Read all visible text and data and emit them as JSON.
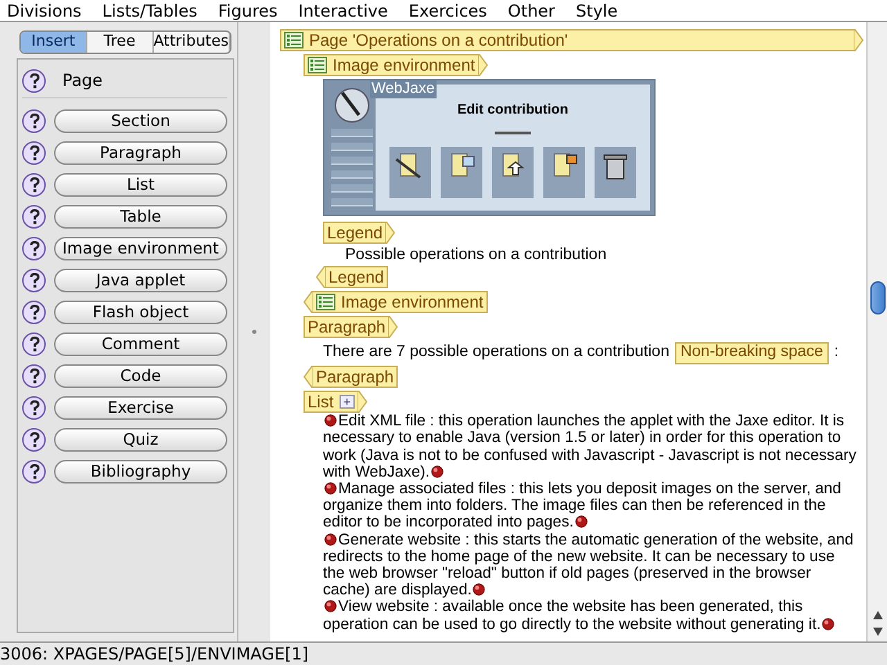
{
  "menu": [
    "Divisions",
    "Lists/Tables",
    "Figures",
    "Interactive",
    "Exercices",
    "Other",
    "Style"
  ],
  "sidebar": {
    "tabs": [
      {
        "label": "Insert",
        "selected": true
      },
      {
        "label": "Tree",
        "selected": false
      },
      {
        "label": "Attributes",
        "selected": false
      }
    ],
    "items": [
      {
        "kind": "label",
        "label": "Page"
      },
      {
        "kind": "button",
        "label": "Section"
      },
      {
        "kind": "button",
        "label": "Paragraph"
      },
      {
        "kind": "button",
        "label": "List"
      },
      {
        "kind": "button",
        "label": "Table"
      },
      {
        "kind": "button",
        "label": "Image environment"
      },
      {
        "kind": "button",
        "label": "Java applet"
      },
      {
        "kind": "button",
        "label": "Flash object"
      },
      {
        "kind": "button",
        "label": "Comment"
      },
      {
        "kind": "button",
        "label": "Code"
      },
      {
        "kind": "button",
        "label": "Exercise"
      },
      {
        "kind": "button",
        "label": "Quiz"
      },
      {
        "kind": "button",
        "label": "Bibliography"
      }
    ]
  },
  "document": {
    "page_tag": "Page 'Operations on  a contribution'",
    "image_environment": {
      "start_tag": "Image environment",
      "image": {
        "brand": "WebJaxe",
        "title": "Edit contribution"
      },
      "legend_start": "Legend",
      "legend_text": "Possible operations on a contribution",
      "legend_end": "Legend",
      "end_tag": "Image environment"
    },
    "paragraph": {
      "start_tag": "Paragraph",
      "text": "There are 7 possible operations on a contribution",
      "inline_tag": "Non-breaking space",
      "after": ":",
      "end_tag": "Paragraph"
    },
    "list": {
      "tag": "List",
      "add_button": "+",
      "items": [
        "Edit XML file : this operation launches the applet with the Jaxe editor. It is necessary to enable Java (version 1.5 or later) in order for this operation to work (Java is not to be confused with Javascript - Javascript is not necessary with WebJaxe).",
        "Manage associated files : this lets you deposit images on the server, and organize them into folders. The image files can then be referenced in the editor to be incorporated into pages.",
        "Generate website : this starts the automatic generation of the website, and redirects to the home page of the new website. It can be necessary to use the web browser \"reload\" button if old pages (preserved in the browser cache) are displayed.",
        "View website : available once the website has been generated, this operation can be used to go directly to the website without generating it."
      ]
    }
  },
  "status_bar": "3006: XPAGES/PAGE[5]/ENVIMAGE[1]"
}
